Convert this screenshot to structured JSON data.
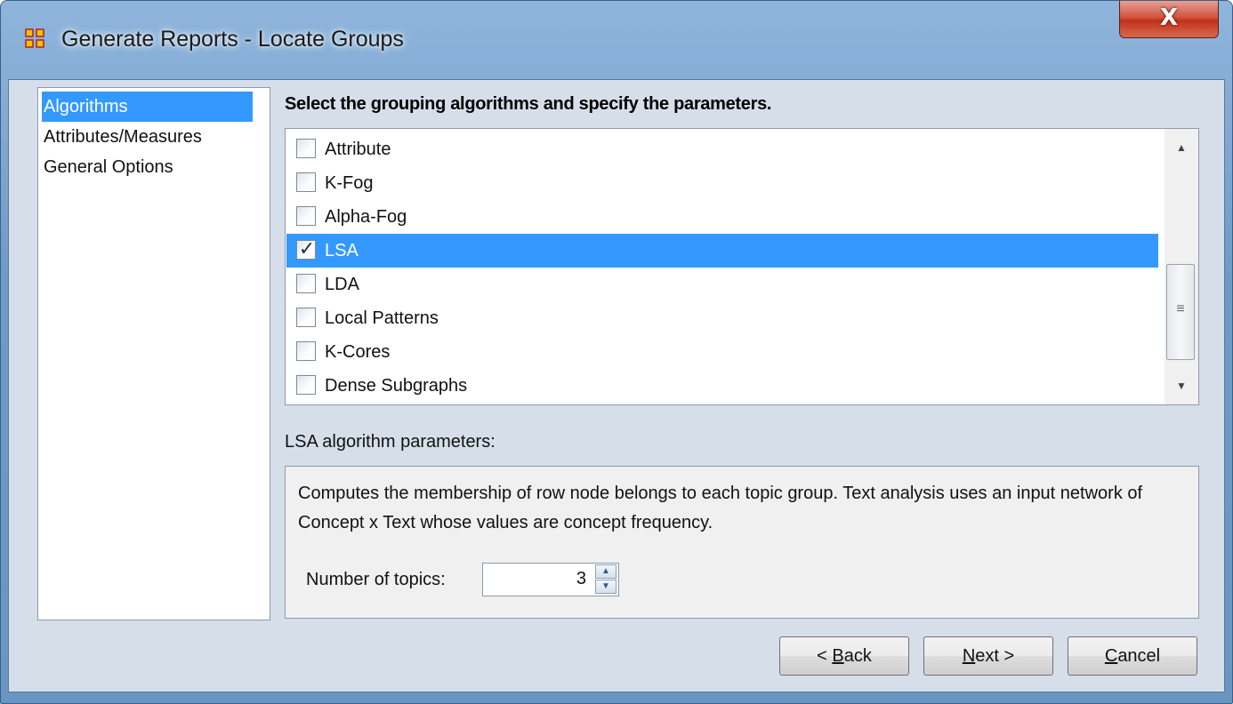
{
  "window": {
    "title": "Generate Reports - Locate Groups",
    "close_label": "X",
    "app_icon": "grid-network-icon"
  },
  "sidebar": {
    "items": [
      {
        "label": "Algorithms",
        "selected": true
      },
      {
        "label": "Attributes/Measures",
        "selected": false
      },
      {
        "label": "General Options",
        "selected": false
      }
    ]
  },
  "main": {
    "heading": "Select the grouping algorithms and specify the parameters.",
    "algorithms": [
      {
        "label": "Attribute",
        "checked": false,
        "selected": false
      },
      {
        "label": "K-Fog",
        "checked": false,
        "selected": false
      },
      {
        "label": "Alpha-Fog",
        "checked": false,
        "selected": false
      },
      {
        "label": "LSA",
        "checked": true,
        "selected": true
      },
      {
        "label": "LDA",
        "checked": false,
        "selected": false
      },
      {
        "label": "Local Patterns",
        "checked": false,
        "selected": false
      },
      {
        "label": "K-Cores",
        "checked": false,
        "selected": false
      },
      {
        "label": "Dense Subgraphs",
        "checked": false,
        "selected": false
      }
    ],
    "params_label": "LSA algorithm parameters:",
    "params_description": "Computes the membership of row node belongs to each topic group. Text analysis uses an input network of Concept x Text whose values are concept frequency.",
    "topics_label": "Number of topics:",
    "topics_value": "3"
  },
  "buttons": {
    "back": {
      "prefix": "< ",
      "mnemonic": "B",
      "rest": "ack"
    },
    "next": {
      "prefix": "",
      "mnemonic": "N",
      "rest": "ext >"
    },
    "cancel": {
      "prefix": "",
      "mnemonic": "C",
      "rest": "ancel"
    }
  },
  "colors": {
    "selection": "#3399ff",
    "content_bg": "#d6dfe9",
    "titlebar": "#6f9ac6",
    "close_button": "#c2311a"
  }
}
